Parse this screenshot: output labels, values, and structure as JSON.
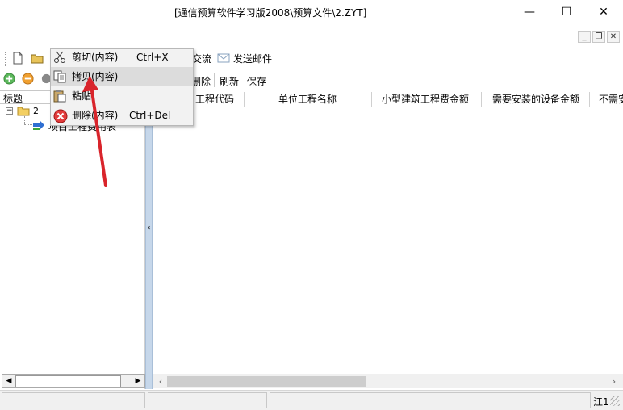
{
  "window": {
    "title": "[通信预算软件学习版2008\\预算文件\\2.ZYT]",
    "minimize": "—",
    "maximize": "☐",
    "close": "✕",
    "mdi_min": "_",
    "mdi_restore": "❐",
    "mdi_close": "✕"
  },
  "toolbar": {
    "exchange_label": "交流",
    "send_mail_label": "发送邮件"
  },
  "subtoolbar": {
    "delete_label": "删除",
    "refresh_label": "刷新",
    "save_label": "保存"
  },
  "tree": {
    "header": "标题",
    "node_label": "2",
    "child_label": "项目工程费用表"
  },
  "table": {
    "columns": [
      "位工程代码",
      "单位工程名称",
      "小型建筑工程费金额",
      "需要安装的设备金额",
      "不需安"
    ]
  },
  "context_menu": {
    "items": [
      {
        "label": "剪切(内容)",
        "shortcut": "Ctrl+X",
        "icon": "scissors-icon"
      },
      {
        "label": "拷贝(内容)",
        "shortcut": "",
        "icon": "copy-icon"
      },
      {
        "label": "粘贴",
        "shortcut": "",
        "icon": "paste-icon"
      },
      {
        "label": "删除(内容)",
        "shortcut": "Ctrl+Del",
        "icon": "delete-icon"
      }
    ]
  },
  "statusbar": {
    "right_text": "江1"
  },
  "colors": {
    "arrow": "#d9242b",
    "splitter": "#c6d7ea",
    "scroll_track": "#f0f0f0",
    "scroll_thumb": "#cdcdcd"
  }
}
